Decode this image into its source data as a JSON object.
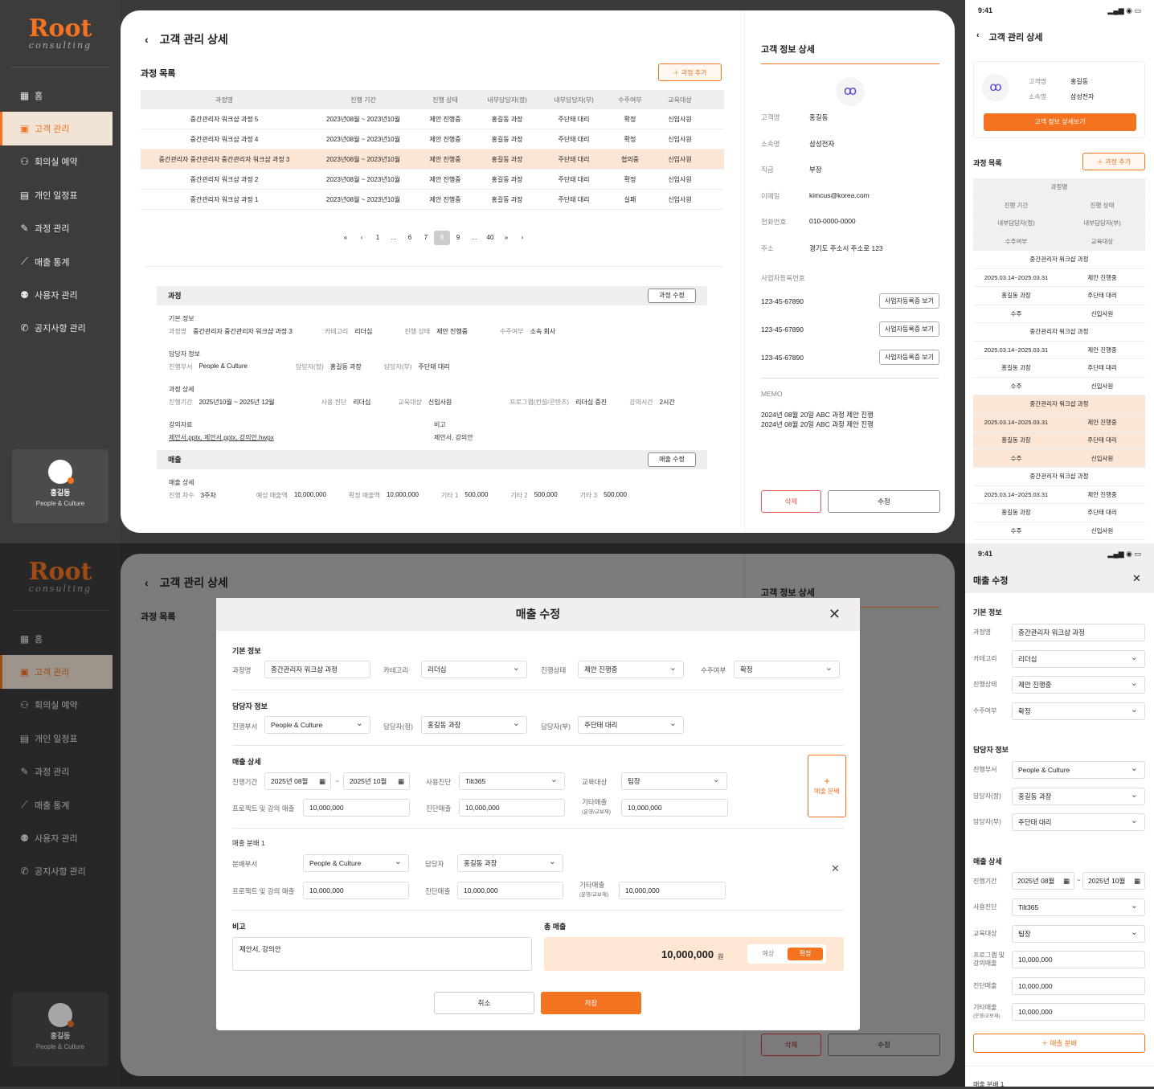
{
  "brand": {
    "logo": "Root",
    "sub": "consulting"
  },
  "nav": [
    "홈",
    "고객 관리",
    "회의실 예약",
    "개인 일정표",
    "과정 관리",
    "매출 통계",
    "사용자 관리",
    "공지사항 관리"
  ],
  "nav_icons": [
    "grid-icon",
    "person-card-icon",
    "meeting-icon",
    "calendar-icon",
    "edit-icon",
    "chart-icon",
    "user-icon",
    "megaphone-icon"
  ],
  "user": {
    "name": "홍길동",
    "dept": "People & Culture"
  },
  "page": {
    "title": "고객 관리 상세",
    "course_list": "과정 목록",
    "add_course": "＋ 과정 추가"
  },
  "table": {
    "headers": [
      "과정명",
      "진행 기간",
      "진행 상태",
      "내부담당자(정)",
      "내부담당자(부)",
      "수주여부",
      "교육대상"
    ],
    "rows": [
      [
        "중간관리자 워크샵 과정 5",
        "2023년08월 ~ 2023년10월",
        "제안 진행중",
        "홍길동 과장",
        "주단태 대리",
        "확정",
        "신입사원"
      ],
      [
        "중간관리자 워크샵 과정 4",
        "2023년08월 ~ 2023년10월",
        "제안 진행중",
        "홍길동 과장",
        "주단태 대리",
        "확정",
        "신입사원"
      ],
      [
        "중간관리자 중간관리자 중간관리자 워크샵 과정 3",
        "2023년08월 ~ 2023년10월",
        "제안 진행중",
        "홍길동 과장",
        "주단태 대리",
        "협의중",
        "신입사원"
      ],
      [
        "중간관리자 워크샵 과정 2",
        "2023년08월 ~ 2023년10월",
        "제안 진행중",
        "홍길동 과장",
        "주단태 대리",
        "확정",
        "신입사원"
      ],
      [
        "중간관리자 워크샵 과정 1",
        "2023년08월 ~ 2023년10월",
        "제안 진행중",
        "홍길동 과장",
        "주단태 대리",
        "실패",
        "신입사원"
      ]
    ]
  },
  "pager": [
    "«",
    "‹",
    "1",
    "...",
    "6",
    "7",
    "8",
    "9",
    "...",
    "40",
    "»",
    "›"
  ],
  "detail": {
    "course": "과정",
    "edit": "과정 수정",
    "basic": "기본 정보",
    "basic_row": [
      [
        "과정명",
        "중간관리자 중간관리자 워크샵 과정 3"
      ],
      [
        "카테고리",
        "리더십"
      ],
      [
        "진행 상태",
        "제안 진행중"
      ],
      [
        "수주여부",
        "소속 회사"
      ]
    ],
    "mgr": "담당자 정보",
    "mgr_row": [
      [
        "진행부서",
        "People & Culture"
      ],
      [
        "담당자(정)",
        "홍길동 과장"
      ],
      [
        "담당자(부)",
        "주단태 대리"
      ]
    ],
    "cdetail": "과정 상세",
    "cdetail_row": [
      [
        "진행기간",
        "2025년10월 ~ 2025년 12월"
      ],
      [
        "사용 진단",
        "리더십"
      ],
      [
        "교육대상",
        "신입사원"
      ],
      [
        "프로그램(컨설/콘텐츠)",
        "리더십 증진"
      ],
      [
        "강의시간",
        "2시간"
      ]
    ],
    "material": "강의자료",
    "files": "제안서.pptx, 제안서.pptx, 강의안.hwpx",
    "note": "비고",
    "note_val": "제안서, 강의안",
    "sales": "매출",
    "sales_edit": "매출 수정",
    "sales_detail": "매출 상세",
    "sales_row": [
      [
        "진행 차수",
        "3주차"
      ],
      [
        "예상 매출액",
        "10,000,000"
      ],
      [
        "확정 매출액",
        "10,000,000"
      ],
      [
        "기타 1",
        "500,000"
      ],
      [
        "기타 2",
        "500,000"
      ],
      [
        "기타 3",
        "500,000"
      ]
    ]
  },
  "customer": {
    "title": "고객 정보 상세",
    "fields": [
      [
        "고객명",
        "홍길동"
      ],
      [
        "소속명",
        "삼성전자"
      ],
      [
        "직급",
        "부장"
      ],
      [
        "이메일",
        "kimcus@korea.com"
      ],
      [
        "전화번호",
        "010-0000-0000"
      ],
      [
        "주소",
        "경기도 주소시 주소로 123"
      ]
    ],
    "biz_label": "사업자등록번호",
    "biz": [
      "123-45-67890",
      "123-45-67890",
      "123-45-67890"
    ],
    "biz_btn": "사업자등록증 보기",
    "memo_label": "MEMO",
    "memo": [
      "2024년 08월 20일 ABC 과정 제안 진행",
      "2024년 08월 20일 ABC 과정 제안 진행"
    ],
    "delete": "삭제",
    "edit": "수정"
  },
  "mobile": {
    "time": "9:41",
    "title": "고객 관리 상세",
    "k1": "고객명",
    "v1": "홍길동",
    "k2": "소속명",
    "v2": "삼성전자",
    "detail_btn": "고객 정보 상세보기",
    "list": "과정 목록",
    "add": "＋ 과정 추가",
    "head": [
      [
        "과정명"
      ],
      [
        "진행 기간",
        "진행 상태"
      ],
      [
        "내부담당자(정)",
        "내부담당자(부)"
      ],
      [
        "수주여부",
        "교육대상"
      ]
    ],
    "item": [
      [
        "중간관리자 워크샵 과정"
      ],
      [
        "2025.03.14~2025.03.31",
        "제안 진행중"
      ],
      [
        "홍길동 과장",
        "주단태 대리"
      ],
      [
        "수주",
        "신입사원"
      ]
    ]
  },
  "modal": {
    "title": "매출 수정",
    "basic": "기본 정보",
    "course_lbl": "과정명",
    "course": "중간관리자 워크샵 과정",
    "cat_lbl": "카테고리",
    "cat": "리더십",
    "status_lbl": "진행상태",
    "status": "제안 진행중",
    "order_lbl": "수주여부",
    "order": "확정",
    "mgr": "담당자 정보",
    "dept_lbl": "진행부서",
    "dept": "People & Culture",
    "m1_lbl": "담당자(정)",
    "m1": "홍길동 과장",
    "m2_lbl": "담당자(부)",
    "m2": "주단태 대리",
    "sales": "매출 상세",
    "period_lbl": "진행기간",
    "from": "2025년 08월",
    "to": "2025년 10월",
    "diag_lbl": "사용진단",
    "diag": "Tilt365",
    "target_lbl": "교육대상",
    "target": "팀장",
    "proj_lbl": "프로젝트 및 강의 매출",
    "proj": "10,000,000",
    "diag_s_lbl": "진단매출",
    "diag_s": "10,000,000",
    "etc_lbl": "기타매출",
    "etc_sub": "(운영/교보재)",
    "etc": "10,000,000",
    "split_btn": "매출 분배",
    "split1": "매출 분배 1",
    "sdept_lbl": "분배부서",
    "sdept": "People & Culture",
    "smgr_lbl": "담당자",
    "smgr": "홍길동 과장",
    "note": "비고",
    "note_val": "제안서, 강의안",
    "total": "총 매출",
    "total_val": "10,000,000",
    "won": "원",
    "t1": "예상",
    "t2": "확정",
    "cancel": "취소",
    "save": "저장"
  },
  "mobile2": {
    "time": "9:41",
    "title": "매출 수정",
    "basic": "기본 정보",
    "rows1": [
      [
        "과정명",
        "중간관리자 워크샵 과정"
      ],
      [
        "카테고리",
        "리더십"
      ],
      [
        "진행상태",
        "제안 진행중"
      ],
      [
        "수주여부",
        "확정"
      ]
    ],
    "mgr": "담당자 정보",
    "rows2": [
      [
        "진행부서",
        "People & Culture"
      ],
      [
        "담당자(정)",
        "홍길동 과장"
      ],
      [
        "담당자(부)",
        "주단태 대리"
      ]
    ],
    "sales": "매출 상세",
    "period_lbl": "진행기간",
    "from": "2025년 08월",
    "to": "2025년 10월",
    "rows3": [
      [
        "사용진단",
        "Tilt365"
      ],
      [
        "교육대상",
        "팀장"
      ],
      [
        "프로그램 및 강의매출",
        "10,000,000"
      ],
      [
        "진단매출",
        "10,000,000"
      ],
      [
        "기타매출",
        "10,000,000"
      ]
    ],
    "etc_sub": "(운영/교보재)",
    "split": "＋ 매출 분배",
    "split1": "매출 분배 1"
  }
}
